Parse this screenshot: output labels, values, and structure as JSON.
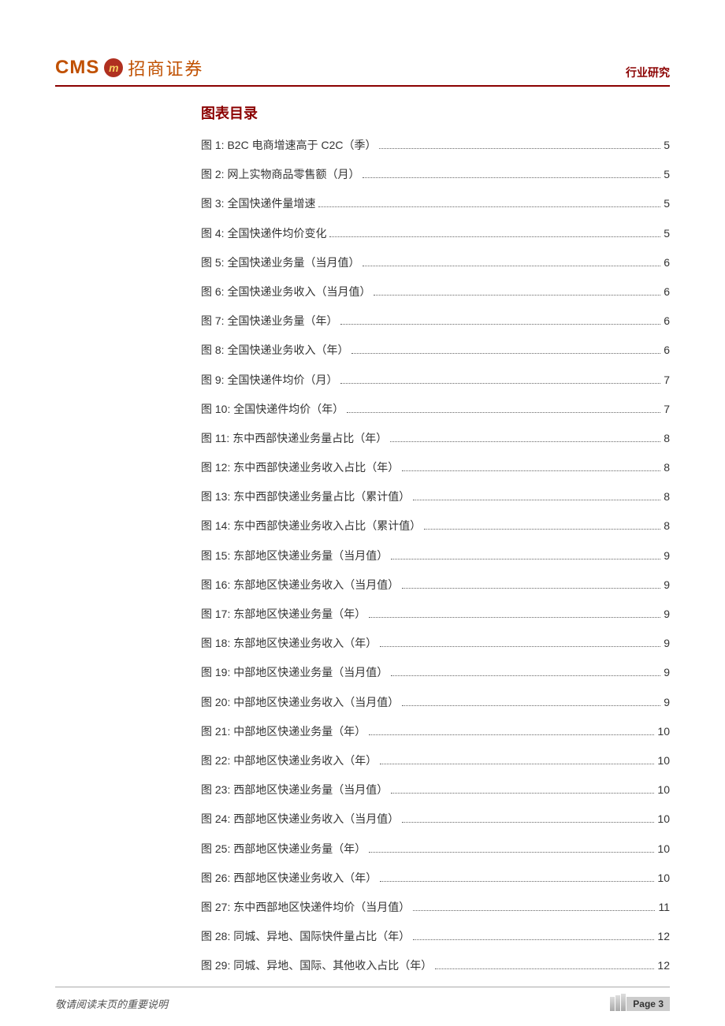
{
  "header": {
    "logo_cms": "CMS",
    "logo_circle": "m",
    "logo_chinese": "招商证券",
    "right_label": "行业研究"
  },
  "toc": {
    "title": "图表目录",
    "entries": [
      {
        "label": "图 1:  B2C 电商增速高于 C2C（季）",
        "page": "5"
      },
      {
        "label": "图 2:  网上实物商品零售额（月）",
        "page": "5"
      },
      {
        "label": "图 3:  全国快递件量增速",
        "page": "5"
      },
      {
        "label": "图 4:  全国快递件均价变化",
        "page": "5"
      },
      {
        "label": "图 5:  全国快递业务量（当月值）",
        "page": "6"
      },
      {
        "label": "图 6:  全国快递业务收入（当月值）",
        "page": "6"
      },
      {
        "label": "图 7:  全国快递业务量（年）",
        "page": "6"
      },
      {
        "label": "图 8:  全国快递业务收入（年）",
        "page": "6"
      },
      {
        "label": "图 9:  全国快递件均价（月）",
        "page": "7"
      },
      {
        "label": "图 10:  全国快递件均价（年）",
        "page": "7"
      },
      {
        "label": "图 11:  东中西部快递业务量占比（年）",
        "page": "8"
      },
      {
        "label": "图 12:  东中西部快递业务收入占比（年）",
        "page": "8"
      },
      {
        "label": "图 13:  东中西部快递业务量占比（累计值）",
        "page": "8"
      },
      {
        "label": "图 14:  东中西部快递业务收入占比（累计值）",
        "page": "8"
      },
      {
        "label": "图 15:  东部地区快递业务量（当月值）",
        "page": "9"
      },
      {
        "label": "图 16:  东部地区快递业务收入（当月值）",
        "page": "9"
      },
      {
        "label": "图 17:  东部地区快递业务量（年）",
        "page": "9"
      },
      {
        "label": "图 18:  东部地区快递业务收入（年）",
        "page": "9"
      },
      {
        "label": "图 19:  中部地区快递业务量（当月值）",
        "page": "9"
      },
      {
        "label": "图 20:  中部地区快递业务收入（当月值）",
        "page": "9"
      },
      {
        "label": "图 21:  中部地区快递业务量（年）",
        "page": "10"
      },
      {
        "label": "图 22:  中部地区快递业务收入（年）",
        "page": "10"
      },
      {
        "label": "图 23:  西部地区快递业务量（当月值）",
        "page": "10"
      },
      {
        "label": "图 24:  西部地区快递业务收入（当月值）",
        "page": "10"
      },
      {
        "label": "图 25:  西部地区快递业务量（年）",
        "page": "10"
      },
      {
        "label": "图 26:  西部地区快递业务收入（年）",
        "page": "10"
      },
      {
        "label": "图 27:  东中西部地区快递件均价（当月值）",
        "page": "11"
      },
      {
        "label": "图 28:  同城、异地、国际快件量占比（年）",
        "page": "12"
      },
      {
        "label": "图 29:  同城、异地、国际、其他收入占比（年）",
        "page": "12"
      }
    ]
  },
  "footer": {
    "left_text": "敬请阅读末页的重要说明",
    "page_label": "Page 3"
  }
}
